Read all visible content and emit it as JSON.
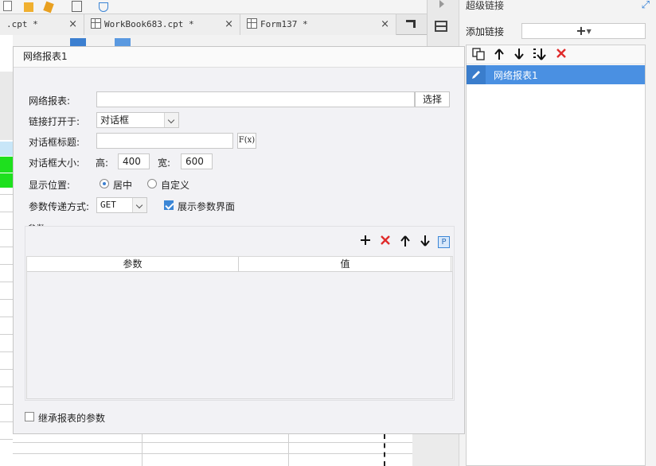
{
  "editor": {
    "tabs": [
      {
        "label": ".cpt *"
      },
      {
        "label": "WorkBook683.cpt *"
      },
      {
        "label": "Form137 *"
      }
    ],
    "close_glyph": "×"
  },
  "hyperlink_panel": {
    "title": "超级链接",
    "add_label": "添加链接",
    "add_glyph": "+",
    "toolbar_icons": [
      "copy-icon",
      "arrow-up-icon",
      "arrow-down-icon",
      "sort-down-icon",
      "delete-icon"
    ],
    "items": [
      {
        "label": "网络报表1",
        "icon": "edit-icon",
        "selected": true
      }
    ]
  },
  "dialog": {
    "title": "网络报表1",
    "fields": {
      "report_label": "网络报表:",
      "report_value": "",
      "select_button": "选择",
      "open_in_label": "链接打开于:",
      "open_in_value": "对话框",
      "dialog_title_label": "对话框标题:",
      "dialog_title_value": "",
      "formula_button": "F(x)",
      "size_label": "对话框大小:",
      "height_label": "高:",
      "height_value": "400",
      "width_label": "宽:",
      "width_value": "600",
      "position_label": "显示位置:",
      "position_center": "居中",
      "position_custom": "自定义",
      "position_selected": "center",
      "param_method_label": "参数传递方式:",
      "param_method_value": "GET",
      "show_params_label": "展示参数界面",
      "show_params_checked": true
    },
    "params": {
      "group_label": "参数",
      "toolbar_icons": [
        "add-icon",
        "delete-icon",
        "arrow-up-icon",
        "arrow-down-icon",
        "parameter-icon"
      ],
      "param_badge": "P",
      "columns": [
        "参数",
        "值"
      ],
      "rows": []
    },
    "inherit_label": "继承报表的参数",
    "inherit_checked": false
  }
}
